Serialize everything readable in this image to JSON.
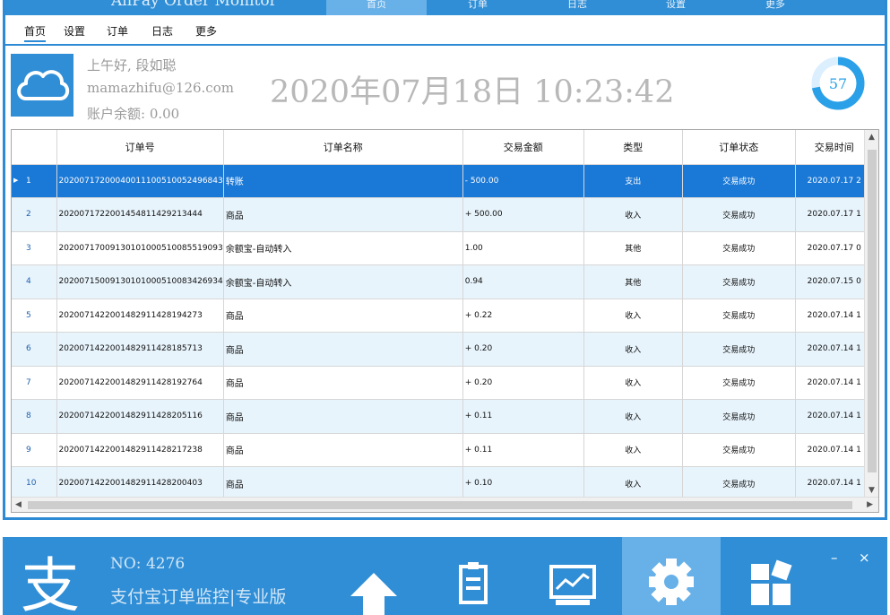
{
  "app": {
    "title": "AliPay Order Monitor"
  },
  "top_tabs": [
    "首页",
    "订单",
    "日志",
    "设置",
    "更多"
  ],
  "menu_tabs": [
    "首页",
    "设置",
    "订单",
    "日志",
    "更多"
  ],
  "user": {
    "greeting": "上午好, 段如聪",
    "email": "mamazhifu@126.com",
    "balance": "账户余额: 0.00"
  },
  "clock": "2020年07月18日  10:23:42",
  "gauge": {
    "value": "57",
    "fill_fraction": 0.72
  },
  "table": {
    "headers": [
      "订单号",
      "订单名称",
      "交易金额",
      "类型",
      "订单状态",
      "交易时间"
    ],
    "rows": [
      {
        "idx": "1",
        "order_no": "20200717200040011100510052496843",
        "name": "转账",
        "amount": "- 500.00",
        "type": "支出",
        "status": "交易成功",
        "time": "2020.07.17 2"
      },
      {
        "idx": "2",
        "order_no": "20200717220014548114292134​44",
        "name": "商品",
        "amount": "+ 500.00",
        "type": "收入",
        "status": "交易成功",
        "time": "2020.07.17 1"
      },
      {
        "idx": "3",
        "order_no": "20200717009130101000510085519093",
        "name": "余额宝-自动转入",
        "amount": "1.00",
        "type": "其他",
        "status": "交易成功",
        "time": "2020.07.17 0"
      },
      {
        "idx": "4",
        "order_no": "20200715009130101000510083426934",
        "name": "余额宝-自动转入",
        "amount": "0.94",
        "type": "其他",
        "status": "交易成功",
        "time": "2020.07.15 0"
      },
      {
        "idx": "5",
        "order_no": "2020071422001482911428194273",
        "name": "商品",
        "amount": "+ 0.22",
        "type": "收入",
        "status": "交易成功",
        "time": "2020.07.14 1"
      },
      {
        "idx": "6",
        "order_no": "2020071422001482911428185713",
        "name": "商品",
        "amount": "+ 0.20",
        "type": "收入",
        "status": "交易成功",
        "time": "2020.07.14 1"
      },
      {
        "idx": "7",
        "order_no": "2020071422001482911428192764",
        "name": "商品",
        "amount": "+ 0.20",
        "type": "收入",
        "status": "交易成功",
        "time": "2020.07.14 1"
      },
      {
        "idx": "8",
        "order_no": "2020071422001482911428205116",
        "name": "商品",
        "amount": "+ 0.11",
        "type": "收入",
        "status": "交易成功",
        "time": "2020.07.14 1"
      },
      {
        "idx": "9",
        "order_no": "2020071422001482911428217238",
        "name": "商品",
        "amount": "+ 0.11",
        "type": "收入",
        "status": "交易成功",
        "time": "2020.07.14 1"
      },
      {
        "idx": "10",
        "order_no": "2020071422001482911428200403",
        "name": "商品",
        "amount": "+ 0.10",
        "type": "收入",
        "status": "交易成功",
        "time": "2020.07.14 1"
      }
    ]
  },
  "footer": {
    "zhi": "支",
    "no": "NO: 4276",
    "brand": "支付宝订单监控|专业版"
  },
  "colors": {
    "accent": "#2f8ed6",
    "selected_row": "#1a78d6",
    "alt_row": "#e8f4fc",
    "active_tab": "#67b0e8"
  }
}
